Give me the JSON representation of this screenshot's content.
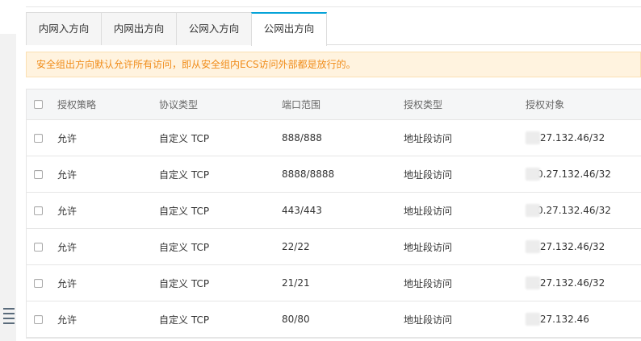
{
  "tabs": [
    {
      "label": "内网入方向",
      "active": false
    },
    {
      "label": "内网出方向",
      "active": false
    },
    {
      "label": "公网入方向",
      "active": false
    },
    {
      "label": "公网出方向",
      "active": true
    }
  ],
  "notice": "安全组出方向默认允许所有访问，即从安全组内ECS访问外部都是放行的。",
  "table": {
    "headers": [
      "授权策略",
      "协议类型",
      "端口范围",
      "授权类型",
      "授权对象"
    ],
    "rows": [
      {
        "policy": "允许",
        "protocol": "自定义 TCP",
        "port": "888/888",
        "auth_type": "地址段访问",
        "auth_object": ".27.132.46/32"
      },
      {
        "policy": "允许",
        "protocol": "自定义 TCP",
        "port": "8888/8888",
        "auth_type": "地址段访问",
        "auth_object": "0.27.132.46/32"
      },
      {
        "policy": "允许",
        "protocol": "自定义 TCP",
        "port": "443/443",
        "auth_type": "地址段访问",
        "auth_object": "0.27.132.46/32"
      },
      {
        "policy": "允许",
        "protocol": "自定义 TCP",
        "port": "22/22",
        "auth_type": "地址段访问",
        "auth_object": ".27.132.46/32"
      },
      {
        "policy": "允许",
        "protocol": "自定义 TCP",
        "port": "21/21",
        "auth_type": "地址段访问",
        "auth_object": ".27.132.46/32"
      },
      {
        "policy": "允许",
        "protocol": "自定义 TCP",
        "port": "80/80",
        "auth_type": "地址段访问",
        "auth_object": ".27.132.46"
      }
    ]
  },
  "colors": {
    "accent": "#06a3d8",
    "notice_text": "#f08c1a",
    "notice_bg": "#fff3df"
  }
}
